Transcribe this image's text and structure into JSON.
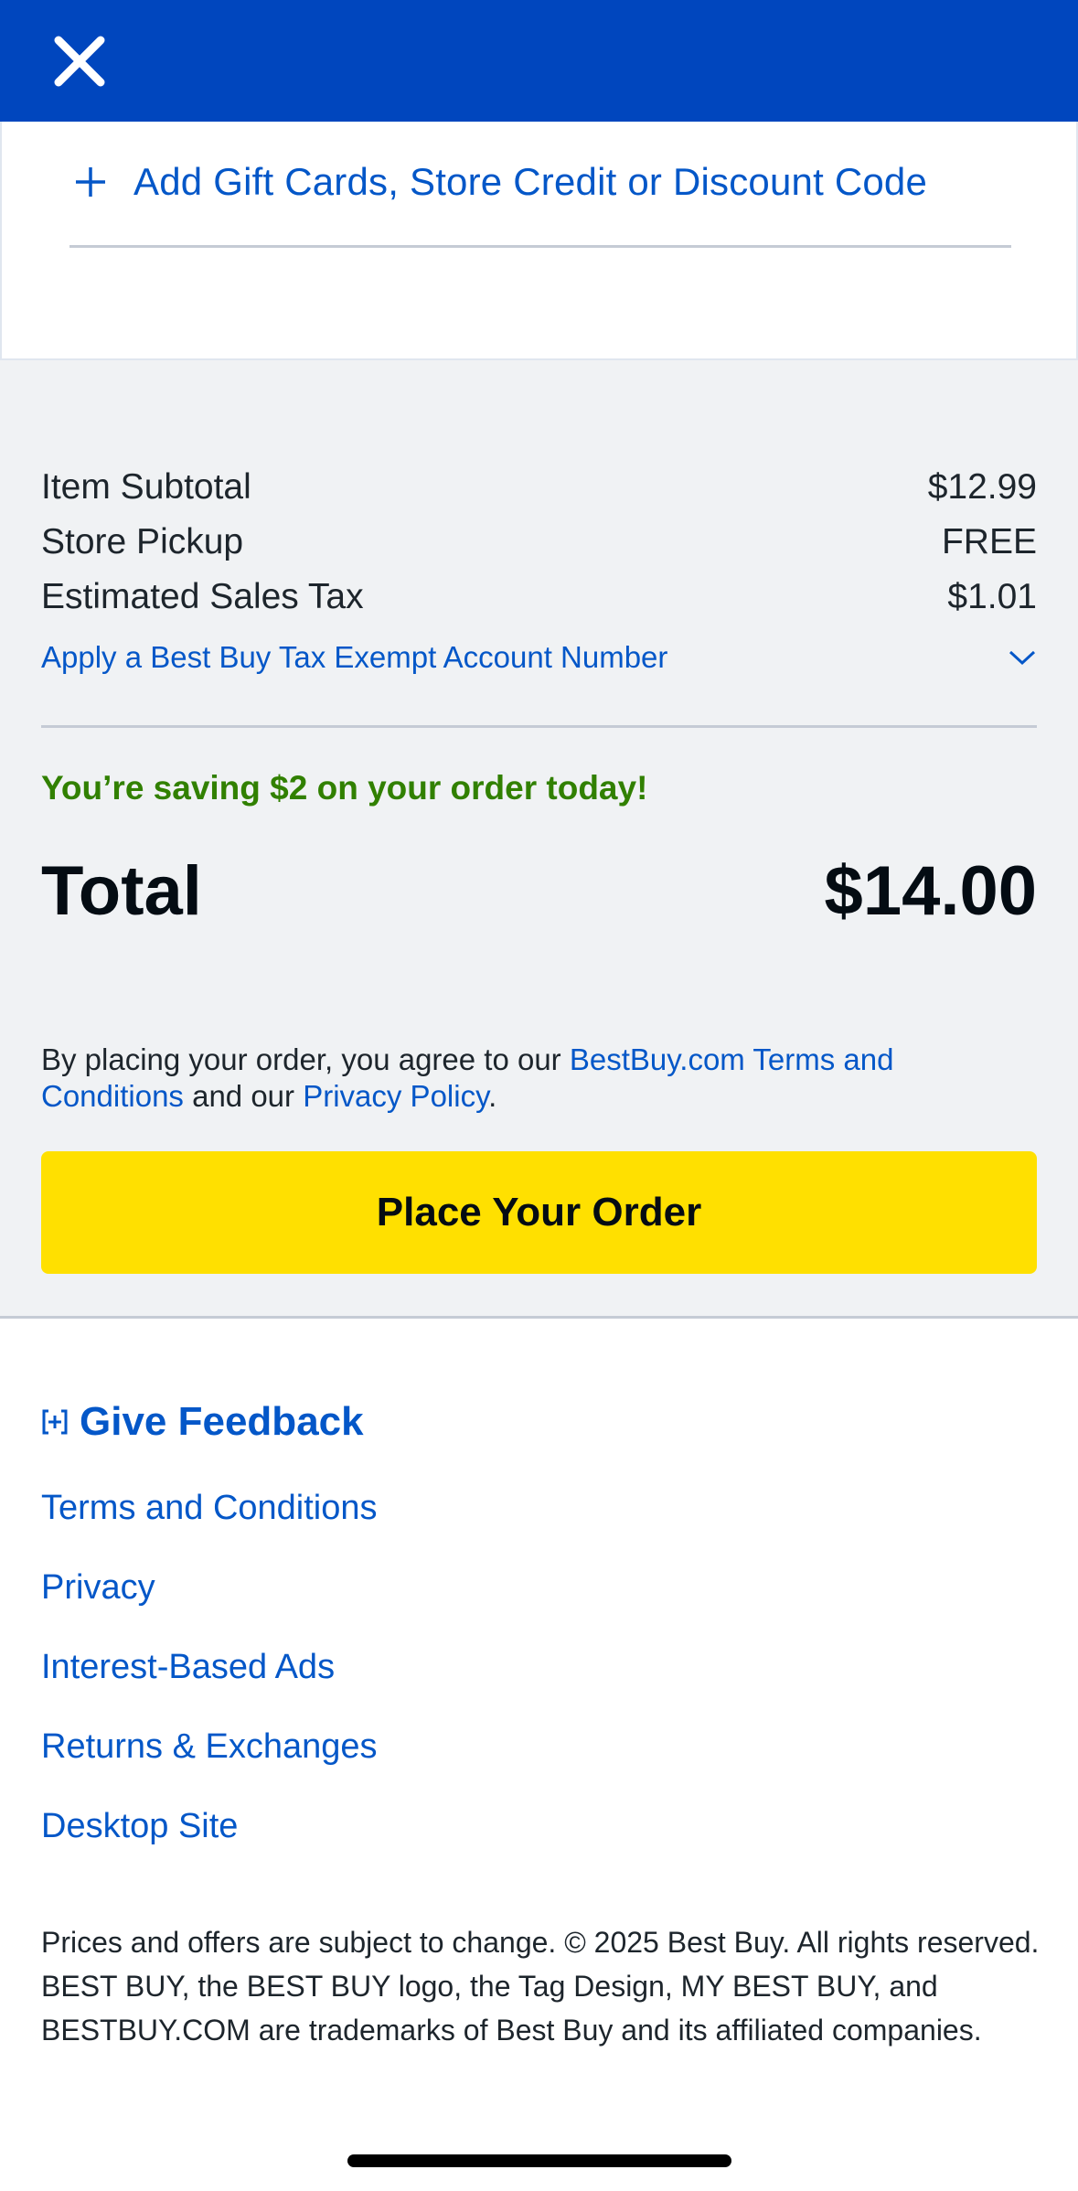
{
  "header": {
    "close_icon": "close-icon",
    "background_color": "#0046be"
  },
  "gift_cards": {
    "icon": "plus-icon",
    "label": "Add Gift Cards, Store Credit or Discount Code"
  },
  "summary": {
    "rows": [
      {
        "label": "Item Subtotal",
        "value": "$12.99"
      },
      {
        "label": "Store Pickup",
        "value": "FREE"
      },
      {
        "label": "Estimated Sales Tax",
        "value": "$1.01"
      }
    ],
    "tax_exempt_label": "Apply a Best Buy Tax Exempt Account Number",
    "tax_exempt_icon": "chevron-down-icon",
    "savings_text": "You’re saving $2 on your order today!",
    "total_label": "Total",
    "total_value": "$14.00"
  },
  "agreement": {
    "prefix": "By placing your order, you agree to our ",
    "terms_link": "BestBuy.com Terms and Conditions",
    "middle": " and our ",
    "privacy_link": "Privacy Policy",
    "suffix": "."
  },
  "place_order": {
    "label": "Place Your Order",
    "color": "#ffe000"
  },
  "footer": {
    "feedback_icon": "feedback-bracket-plus-icon",
    "feedback_label": "Give Feedback",
    "links": [
      "Terms and Conditions",
      "Privacy",
      "Interest-Based Ads",
      "Returns & Exchanges",
      "Desktop Site"
    ],
    "legal": "Prices and offers are subject to change. © 2025 Best Buy. All rights reserved. BEST BUY, the BEST BUY logo, the Tag Design, MY BEST BUY, and BESTBUY.COM are trademarks of Best Buy and its affiliated companies."
  },
  "colors": {
    "link_blue": "#0457c8",
    "savings_green": "#318000",
    "summary_bg": "#f0f2f4"
  }
}
